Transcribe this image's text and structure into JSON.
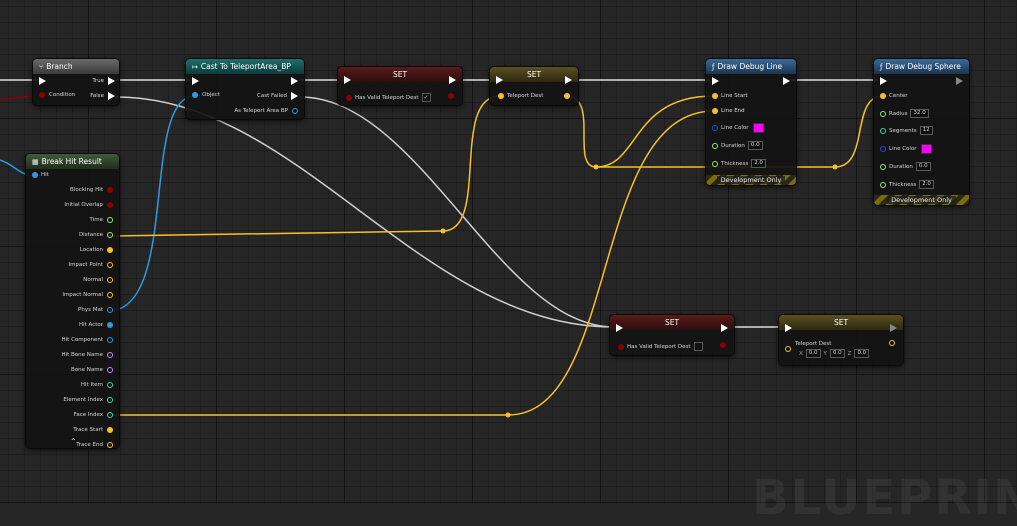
{
  "watermark": "BLUEPRINT",
  "colors": {
    "exec": "#ffffff",
    "bool": "#8c0000",
    "vector": "#f5c12a",
    "object": "#2c9be0",
    "float": "#9be86a",
    "linear_color": "#1d4fd9",
    "name": "#c58cff",
    "int": "#1ee0b0",
    "struct": "#2c9be0"
  },
  "nodes": {
    "branch": {
      "title": "Branch",
      "icon": "branch-icon",
      "pins": {
        "true_label": "True",
        "false_label": "False",
        "condition_label": "Condition"
      }
    },
    "cast": {
      "title": "Cast To TeleportArea_BP",
      "icon": "cast-icon",
      "pins": {
        "object_label": "Object",
        "cast_failed_label": "Cast Failed",
        "as_label": "As Teleport Area BP"
      }
    },
    "set_valid_1": {
      "title": "SET",
      "pin_label": "Has Valid Teleport Dest",
      "checked": "✓"
    },
    "set_dest_1": {
      "title": "SET",
      "pin_label": "Teleport Dest"
    },
    "draw_line": {
      "title": "Draw Debug Line",
      "icon": "function-icon",
      "pins": {
        "line_start": "Line Start",
        "line_end": "Line End",
        "line_color": "Line Color",
        "duration": "Duration",
        "duration_value": "0.0",
        "thickness": "Thickness",
        "thickness_value": "2.0"
      },
      "footer": "Development Only"
    },
    "draw_sphere": {
      "title": "Draw Debug Sphere",
      "icon": "function-icon",
      "pins": {
        "center": "Center",
        "radius": "Radius",
        "radius_value": "32.0",
        "segments": "Segments",
        "segments_value": "12",
        "line_color": "Line Color",
        "duration": "Duration",
        "duration_value": "0.0",
        "thickness": "Thickness",
        "thickness_value": "2.0"
      },
      "footer": "Development Only"
    },
    "break_hit": {
      "title": "Break Hit Result",
      "icon": "struct-icon",
      "hit_label": "Hit",
      "outputs": [
        "Blocking Hit",
        "Initial Overlap",
        "Time",
        "Distance",
        "Location",
        "Impact Point",
        "Normal",
        "Impact Normal",
        "Phys Mat",
        "Hit Actor",
        "Hit Component",
        "Hit Bone Name",
        "Bone Name",
        "Hit Item",
        "Element Index",
        "Face Index",
        "Trace Start",
        "Trace End"
      ],
      "collapse": "⌃"
    },
    "set_valid_2": {
      "title": "SET",
      "pin_label": "Has Valid Teleport Dest"
    },
    "set_dest_2": {
      "title": "SET",
      "pin_label": "Teleport Dest",
      "x_label": "X",
      "x_value": "0.0",
      "y_label": "Y",
      "y_value": "0.0",
      "z_label": "Z",
      "z_value": "0.0"
    }
  }
}
